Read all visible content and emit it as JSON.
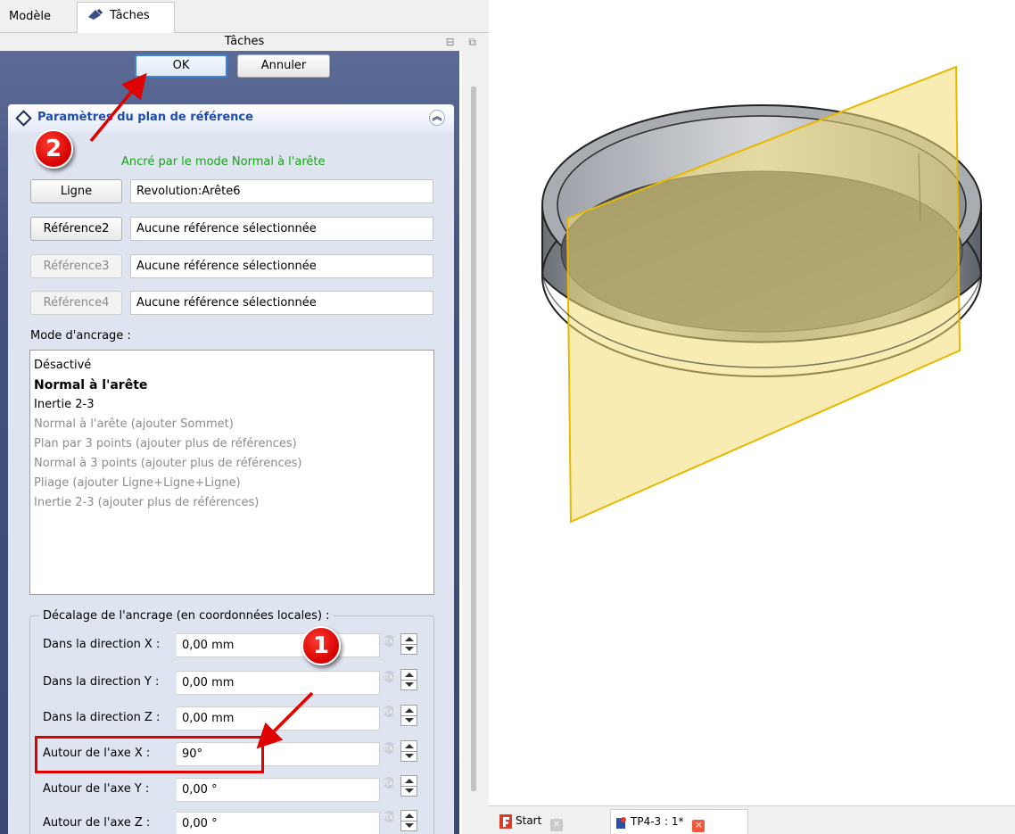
{
  "tabs": {
    "model": "Modèle",
    "tasks": "Tâches"
  },
  "panel": {
    "title": "Tâches"
  },
  "dialog": {
    "ok": "OK",
    "cancel": "Annuler"
  },
  "section": {
    "title": "Paramètres du plan de référence",
    "status": "Ancré par le mode Normal à l'arête"
  },
  "refs": [
    {
      "button": "Ligne",
      "value": "Revolution:Arête6",
      "enabled": true
    },
    {
      "button": "Référence2",
      "value": "Aucune référence sélectionnée",
      "enabled": true
    },
    {
      "button": "Référence3",
      "value": "Aucune référence sélectionnée",
      "enabled": false
    },
    {
      "button": "Référence4",
      "value": "Aucune référence sélectionnée",
      "enabled": false
    }
  ],
  "mode": {
    "label": "Mode d'ancrage :",
    "items": [
      "Désactivé",
      "Normal à l'arête",
      "Inertie 2-3",
      "Normal à l'arête (ajouter Sommet)",
      "Plan par 3 points (ajouter plus de références)",
      "Normal à 3 points (ajouter plus de références)",
      "Pliage (ajouter Ligne+Ligne+Ligne)",
      "Inertie 2-3 (ajouter plus de références)"
    ],
    "selected_index": 1
  },
  "offset": {
    "title": "Décalage de l'ancrage (en coordonnées locales) :",
    "fields": [
      {
        "label": "Dans la direction X :",
        "value": "0,00 mm"
      },
      {
        "label": "Dans la direction Y :",
        "value": "0,00 mm"
      },
      {
        "label": "Dans la direction Z :",
        "value": "0,00 mm"
      },
      {
        "label": "Autour de l'axe X :",
        "value": "90°"
      },
      {
        "label": "Autour de l'axe Y :",
        "value": "0,00 °"
      },
      {
        "label": "Autour de l'axe Z :",
        "value": "0,00 °"
      }
    ],
    "fx_label": "f(x)"
  },
  "annotations": {
    "step1": "1",
    "step2": "2"
  },
  "view": {
    "tabs": [
      {
        "label": "Start",
        "close": "×"
      },
      {
        "label": "TP4-3 : 1*",
        "close": "×"
      }
    ]
  },
  "colors": {
    "panel_bg": "#45527e",
    "box_bg": "#dfe4f1",
    "accent": "#e00000",
    "status_green": "#18a318"
  }
}
